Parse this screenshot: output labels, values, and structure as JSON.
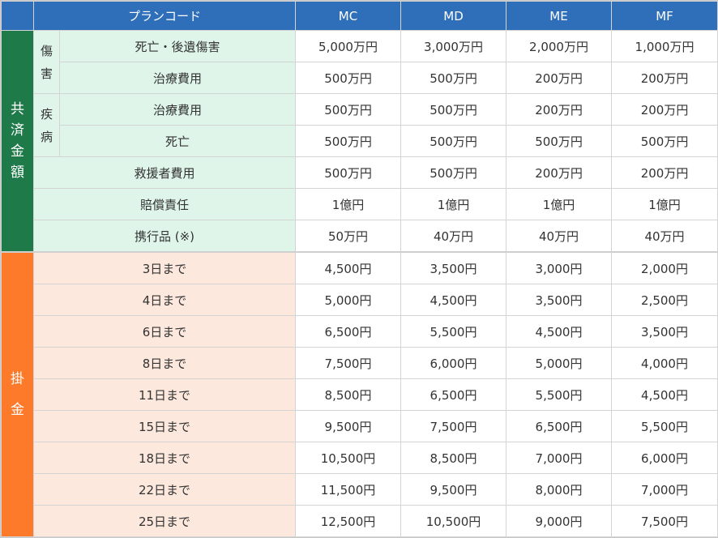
{
  "colors": {
    "header": "#2f6fba",
    "coverage_bg": "#dff5ea",
    "premium_bg": "#fde8de",
    "coverage_side": "#1f7a4a",
    "premium_side": "#fd7a2a"
  },
  "header": {
    "plan_code": "プランコード",
    "plans": [
      "MC",
      "MD",
      "ME",
      "MF"
    ]
  },
  "coverage": {
    "side_label": "共済金額",
    "injury": {
      "label": "傷害",
      "rows": [
        {
          "label": "死亡・後遺傷害",
          "values": [
            "5,000万円",
            "3,000万円",
            "2,000万円",
            "1,000万円"
          ]
        },
        {
          "label": "治療費用",
          "values": [
            "500万円",
            "500万円",
            "200万円",
            "200万円"
          ]
        }
      ]
    },
    "illness": {
      "label": "疾病",
      "rows": [
        {
          "label": "治療費用",
          "values": [
            "500万円",
            "500万円",
            "200万円",
            "200万円"
          ]
        },
        {
          "label": "死亡",
          "values": [
            "500万円",
            "500万円",
            "500万円",
            "500万円"
          ]
        }
      ]
    },
    "other_rows": [
      {
        "label": "救援者費用",
        "values": [
          "500万円",
          "500万円",
          "200万円",
          "200万円"
        ]
      },
      {
        "label": "賠償責任",
        "values": [
          "1億円",
          "1億円",
          "1億円",
          "1億円"
        ]
      },
      {
        "label": "携行品 (※)",
        "values": [
          "50万円",
          "40万円",
          "40万円",
          "40万円"
        ]
      }
    ]
  },
  "premium": {
    "side_label": "掛金",
    "rows": [
      {
        "label": "3日まで",
        "values": [
          "4,500円",
          "3,500円",
          "3,000円",
          "2,000円"
        ]
      },
      {
        "label": "4日まで",
        "values": [
          "5,000円",
          "4,500円",
          "3,500円",
          "2,500円"
        ]
      },
      {
        "label": "6日まで",
        "values": [
          "6,500円",
          "5,500円",
          "4,500円",
          "3,500円"
        ]
      },
      {
        "label": "8日まで",
        "values": [
          "7,500円",
          "6,000円",
          "5,000円",
          "4,000円"
        ]
      },
      {
        "label": "11日まで",
        "values": [
          "8,500円",
          "6,500円",
          "5,500円",
          "4,500円"
        ]
      },
      {
        "label": "15日まで",
        "values": [
          "9,500円",
          "7,500円",
          "6,500円",
          "5,500円"
        ]
      },
      {
        "label": "18日まで",
        "values": [
          "10,500円",
          "8,500円",
          "7,000円",
          "6,000円"
        ]
      },
      {
        "label": "22日まで",
        "values": [
          "11,500円",
          "9,500円",
          "8,000円",
          "7,000円"
        ]
      },
      {
        "label": "25日まで",
        "values": [
          "12,500円",
          "10,500円",
          "9,000円",
          "7,500円"
        ]
      }
    ]
  }
}
